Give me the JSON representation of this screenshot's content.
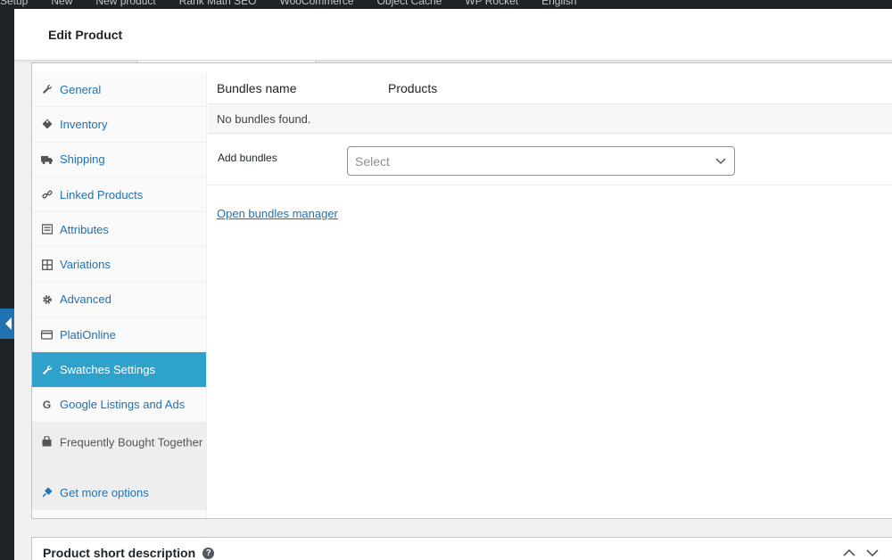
{
  "admin_bar": {
    "items": [
      "Setup",
      "New",
      "New product",
      "Rank Math SEO",
      "WooCommerce",
      "Object Cache",
      "WP Rocket",
      "English"
    ]
  },
  "header": {
    "title": "Edit Product"
  },
  "product_tabs": [
    {
      "label": "General",
      "icon": "wrench-icon"
    },
    {
      "label": "Inventory",
      "icon": "tag-icon"
    },
    {
      "label": "Shipping",
      "icon": "truck-icon"
    },
    {
      "label": "Linked Products",
      "icon": "link-icon"
    },
    {
      "label": "Attributes",
      "icon": "list-icon"
    },
    {
      "label": "Variations",
      "icon": "grid-icon"
    },
    {
      "label": "Advanced",
      "icon": "gear-icon"
    },
    {
      "label": "PlatiOnline",
      "icon": "card-icon"
    },
    {
      "label": "Swatches Settings",
      "icon": "wrench-icon",
      "active": true
    },
    {
      "label": "Google Listings and Ads",
      "icon": "google-icon"
    },
    {
      "label": "Frequently Bought Together",
      "icon": "bag-icon"
    },
    {
      "label": "Get more options",
      "icon": "plugin-icon"
    }
  ],
  "bundles": {
    "col_name": "Bundles name",
    "col_products": "Products",
    "empty_text": "No bundles found.",
    "add_label": "Add bundles",
    "select_placeholder": "Select",
    "manager_link": "Open bundles manager"
  },
  "short_description": {
    "title": "Product short description",
    "help": "?"
  },
  "colors": {
    "accent": "#2271b1",
    "active_tab": "#2ea2cc",
    "admin_dark": "#1d2327"
  }
}
